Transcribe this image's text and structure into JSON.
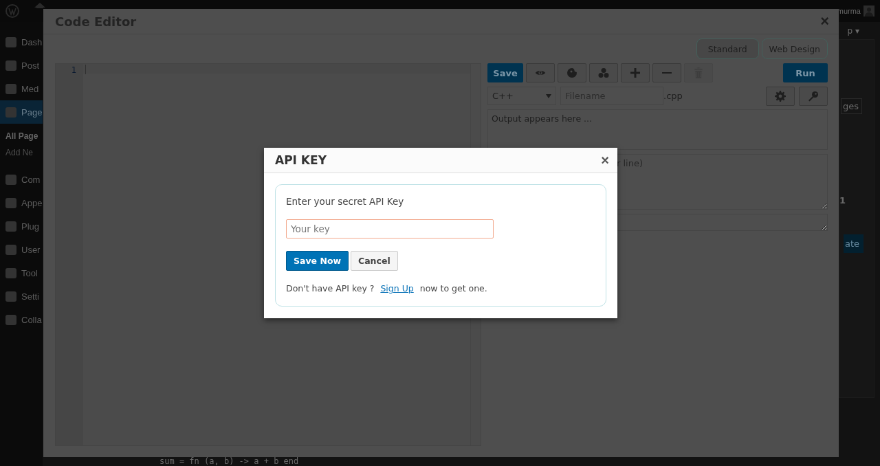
{
  "admin_bar": {
    "user": "murma"
  },
  "sidebar": {
    "items": [
      {
        "label": "Dash",
        "selected": false
      },
      {
        "label": "Post",
        "selected": false
      },
      {
        "label": "Med",
        "selected": false
      },
      {
        "label": "Page",
        "selected": true,
        "children": [
          {
            "label": "All Page",
            "selected": true
          },
          {
            "label": "Add Ne",
            "selected": false
          }
        ]
      },
      {
        "label": "Com",
        "selected": false
      },
      {
        "label": "Appe",
        "selected": false
      },
      {
        "label": "Plug",
        "selected": false
      },
      {
        "label": "User",
        "selected": false
      },
      {
        "label": "Tool",
        "selected": false
      },
      {
        "label": "Setti",
        "selected": false
      },
      {
        "label": "Colla",
        "selected": false
      }
    ]
  },
  "background": {
    "screen_options": "p ▾",
    "button_1": "ges",
    "count": "1",
    "button_2": "ate",
    "code_line": "sum = fn (a, b) -> a + b end"
  },
  "code_editor": {
    "title": "Code Editor",
    "close": "×",
    "modes": [
      {
        "label": "Standard",
        "selected": true
      },
      {
        "label": "Web Design",
        "selected": false
      }
    ],
    "line_numbers": [
      "1"
    ],
    "save": "Save",
    "tool_buttons": [
      {
        "disabled": false
      },
      {
        "disabled": false
      },
      {
        "disabled": false
      },
      {
        "disabled": false
      },
      {
        "disabled": false
      },
      {
        "disabled": true
      }
    ],
    "run": "Run",
    "language": "C++",
    "filename_placeholder": "Filename",
    "extension": ".cpp",
    "output": "Output appears here ...",
    "input_placeholder": "r line)"
  },
  "api_dialog": {
    "title": "API KEY",
    "close": "×",
    "prompt": "Enter your secret API Key",
    "placeholder": "Your key",
    "save": "Save Now",
    "cancel": "Cancel",
    "footer_before": "Don't have API key ?",
    "link": "Sign Up",
    "footer_after": "now to get one."
  }
}
